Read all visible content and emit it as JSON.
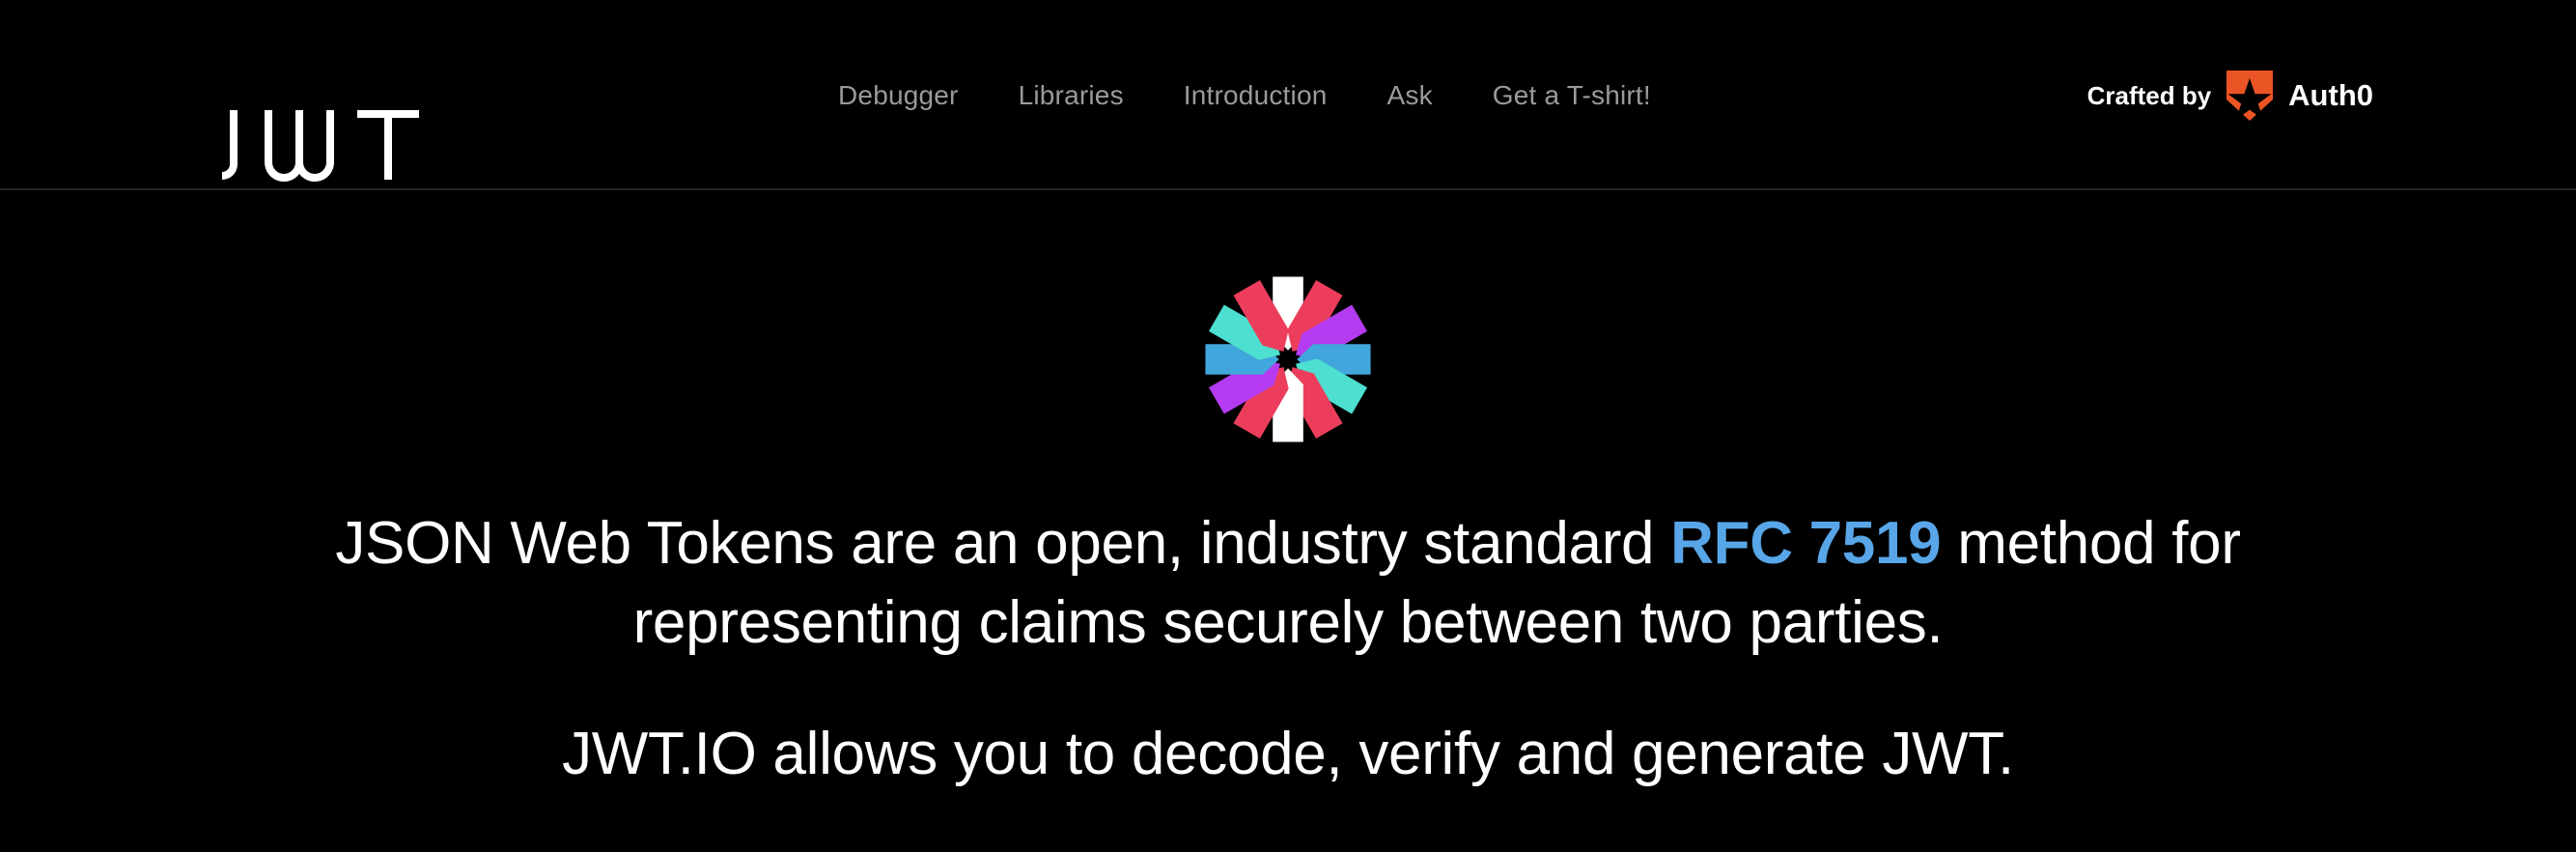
{
  "page": {
    "background_color": "#000000",
    "text_color": "#ffffff"
  },
  "header": {
    "brand": {
      "name": "jwt-logo-wordmark",
      "text": "JWT"
    },
    "nav": {
      "items": [
        {
          "label": "Debugger"
        },
        {
          "label": "Libraries"
        },
        {
          "label": "Introduction"
        },
        {
          "label": "Ask"
        },
        {
          "label": "Get a T-shirt!"
        }
      ],
      "link_color": "#9a9a9a"
    },
    "crafted_by": {
      "label": "Crafted by",
      "brand": "Auth0",
      "icon": "auth0-shield-icon",
      "icon_color": "#EB5424"
    },
    "border_color": "#262626"
  },
  "hero": {
    "logo": {
      "icon": "jwt-pinwheel-icon",
      "spoke_colors": [
        "#ffffff",
        "#EC3E5C",
        "#B43BF0",
        "#41A6DB",
        "#4DDFD0",
        "#ffffff",
        "#EC3E5C",
        "#B43BF0",
        "#41A6DB",
        "#4DDFD0",
        "#EC3E5C",
        "#4DDFD0"
      ]
    },
    "paragraph_1": {
      "before_link": "JSON Web Tokens are an open, industry standard ",
      "link_text": "RFC 7519",
      "link_color": "#58A6E8",
      "after_link": " method for representing claims securely between two parties."
    },
    "paragraph_2": "JWT.IO allows you to decode, verify and generate JWT."
  }
}
